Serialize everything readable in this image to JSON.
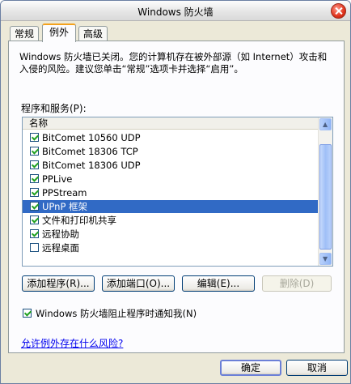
{
  "window": {
    "title": "Windows 防火墙"
  },
  "tabs": [
    {
      "label": "常规"
    },
    {
      "label": "例外"
    },
    {
      "label": "高级"
    }
  ],
  "description": "Windows 防火墙已关闭。您的计算机存在被外部源（如 Internet）攻击和入侵的风险。建议您单击“常规”选项卡并选择“启用”。",
  "programs_label": "程序和服务(P):",
  "list": {
    "header": "名称",
    "items": [
      {
        "label": "BitComet 10560 UDP",
        "checked": true
      },
      {
        "label": "BitComet 18306 TCP",
        "checked": true
      },
      {
        "label": "BitComet 18306 UDP",
        "checked": true
      },
      {
        "label": "PPLive",
        "checked": true
      },
      {
        "label": "PPStream",
        "checked": true
      },
      {
        "label": "UPnP 框架",
        "checked": true,
        "selected": true
      },
      {
        "label": "文件和打印机共享",
        "checked": true
      },
      {
        "label": "远程协助",
        "checked": true
      },
      {
        "label": "远程桌面",
        "checked": false
      }
    ]
  },
  "buttons": {
    "add_program": "添加程序(R)...",
    "add_port": "添加端口(O)...",
    "edit": "编辑(E)...",
    "delete": "删除(D)",
    "ok": "确定",
    "cancel": "取消"
  },
  "notify": {
    "label": "Windows 防火墙阻止程序时通知我(N)",
    "checked": true
  },
  "risk_link": "允许例外存在什么风险?"
}
